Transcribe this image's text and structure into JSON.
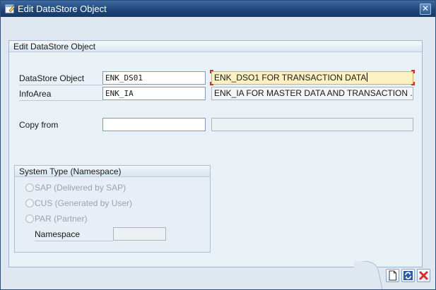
{
  "window": {
    "title": "Edit DataStore Object",
    "close_icon": "close-icon"
  },
  "group": {
    "title": "Edit DataStore Object"
  },
  "fields": {
    "datastore_object": {
      "label": "DataStore Object",
      "value": "ENK_DS01",
      "description": "ENK_DSO1 FOR TRANSACTION DATA"
    },
    "infoarea": {
      "label": "InfoArea",
      "value": "ENK_IA",
      "description": "ENK_IA FOR MASTER DATA AND TRANSACTION ..."
    },
    "copy_from": {
      "label": "Copy from",
      "value": "",
      "description": ""
    }
  },
  "system_type": {
    "title": "System Type (Namespace)",
    "options": [
      {
        "label": "SAP (Delivered by SAP)"
      },
      {
        "label": "CUS (Generated by User)"
      },
      {
        "label": "PAR (Partner)"
      }
    ],
    "namespace_label": "Namespace",
    "namespace_value": ""
  },
  "toolbar": {
    "buttons": [
      {
        "name": "new-document-icon"
      },
      {
        "name": "refresh-icon"
      },
      {
        "name": "cancel-icon"
      }
    ]
  },
  "colors": {
    "titlebar": "#1f4679",
    "active_field": "#fdf0c2",
    "cancel_red": "#d0302a"
  }
}
